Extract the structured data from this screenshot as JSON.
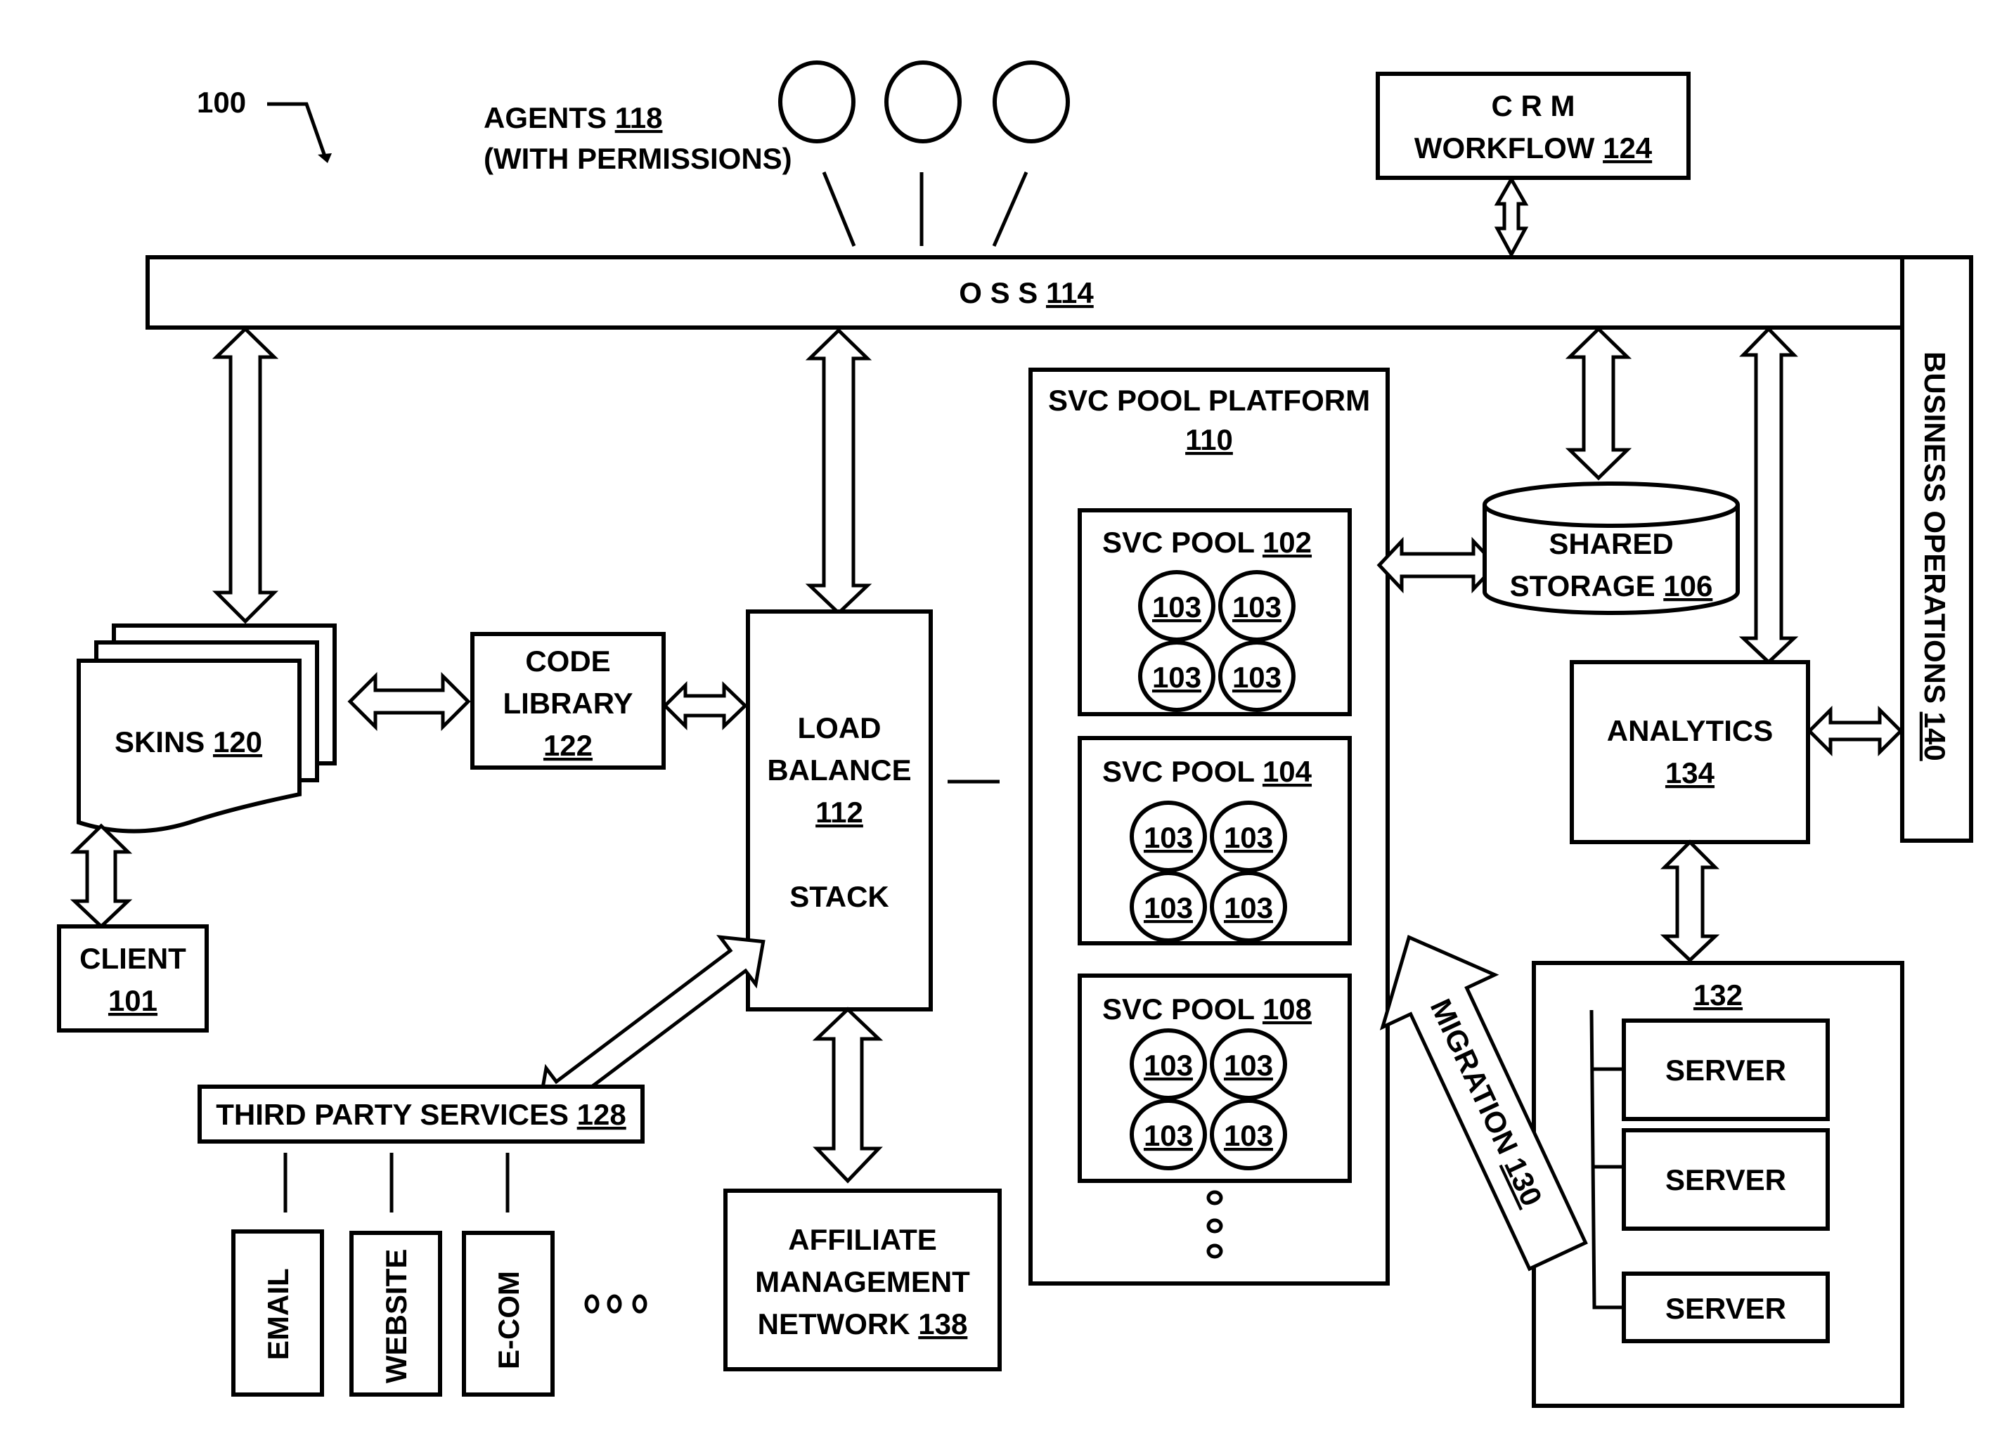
{
  "figure": {
    "ref": "100",
    "agents": {
      "label": "AGENTS",
      "num": "118",
      "sub": "(WITH PERMISSIONS)"
    },
    "crm": {
      "line1": "C R M",
      "line2": "WORKFLOW",
      "num": "124"
    },
    "oss": {
      "label": "O S S",
      "num": "114"
    },
    "business": {
      "label": "BUSINESS OPERATIONS",
      "num": "140"
    },
    "skins": {
      "label": "SKINS",
      "num": "120"
    },
    "client": {
      "label": "CLIENT",
      "num": "101"
    },
    "code_library": {
      "line1": "CODE",
      "line2": "LIBRARY",
      "num": "122"
    },
    "load_balance": {
      "line1": "LOAD",
      "line2": "BALANCE",
      "num": "112",
      "line3": "STACK"
    },
    "platform": {
      "label": "SVC POOL PLATFORM",
      "num": "110"
    },
    "pools": [
      {
        "label": "SVC POOL",
        "num": "102",
        "units": [
          "103",
          "103",
          "103",
          "103"
        ]
      },
      {
        "label": "SVC POOL",
        "num": "104",
        "units": [
          "103",
          "103",
          "103",
          "103"
        ]
      },
      {
        "label": "SVC POOL",
        "num": "108",
        "units": [
          "103",
          "103",
          "103",
          "103"
        ]
      }
    ],
    "shared_storage": {
      "line1": "SHARED",
      "line2": "STORAGE",
      "num": "106"
    },
    "analytics": {
      "label": "ANALYTICS",
      "num": "134"
    },
    "server_group": {
      "num": "132",
      "servers": [
        "SERVER",
        "SERVER",
        "SERVER"
      ]
    },
    "migration": {
      "label": "MIGRATION",
      "num": "130"
    },
    "third_party": {
      "label": "THIRD PARTY SERVICES",
      "num": "128"
    },
    "services": [
      "EMAIL",
      "WEBSITE",
      "E-COM"
    ],
    "affiliate": {
      "line1": "AFFILIATE",
      "line2": "MANAGEMENT",
      "line3": "NETWORK",
      "num": "138"
    }
  }
}
